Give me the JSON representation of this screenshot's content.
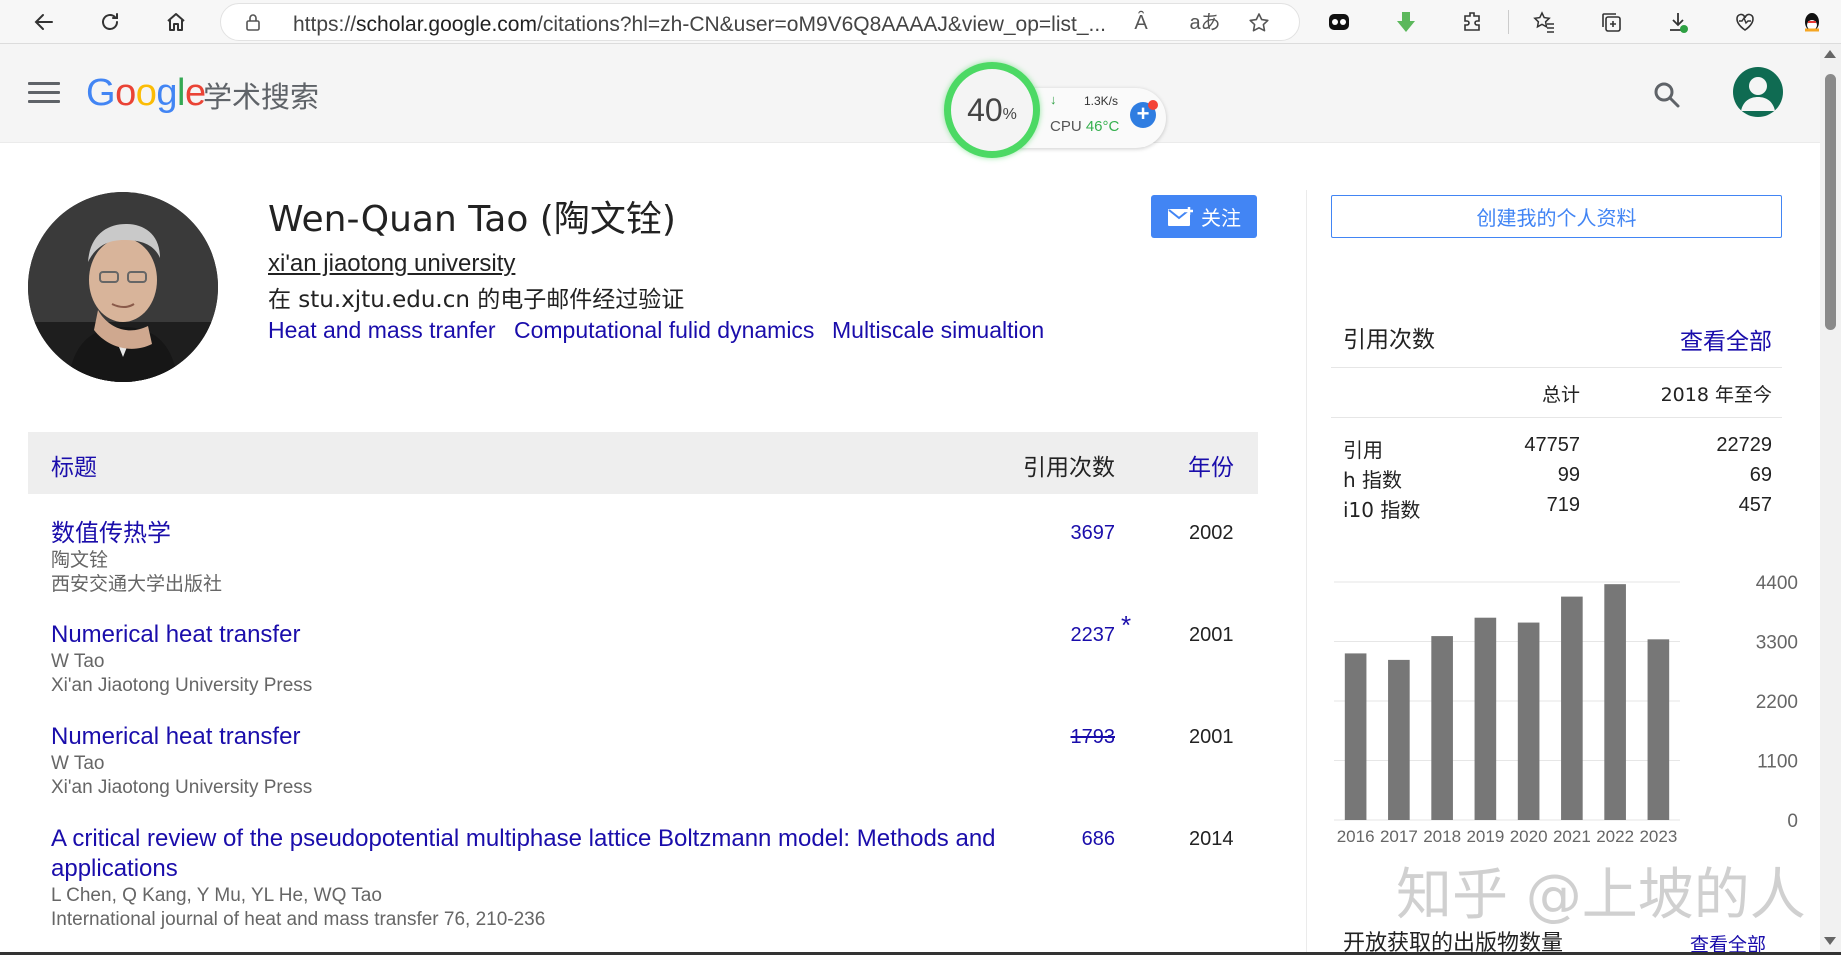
{
  "browser": {
    "url_prefix": "https://",
    "url_host": "scholar.google.com",
    "url_path": "/citations?hl=zh-CN&user=oM9V6Q8AAAAJ&view_op=list_...",
    "read_aloud_label": "Ȃ",
    "translate_label": "aあ"
  },
  "header": {
    "logo_letters": [
      "G",
      "o",
      "o",
      "g",
      "l",
      "e"
    ],
    "logo_colors": [
      "#4285f4",
      "#ea4335",
      "#fbbc05",
      "#4285f4",
      "#34a853",
      "#ea4335"
    ],
    "logo_sub": "学术搜索"
  },
  "cpu_widget": {
    "percent": "40",
    "percent_sign": "%",
    "arrow": "↓",
    "speed": "1.3K/s",
    "label": "CPU ",
    "temp": "46°C",
    "plus": "+",
    "ring_color": "#4cd964"
  },
  "profile": {
    "name": "Wen-Quan Tao (陶文铨)",
    "affiliation": "xi'an jiaotong university",
    "email_verified": "在 stu.xjtu.edu.cn 的电子邮件经过验证",
    "interests": [
      "Heat and mass tranfer",
      "Computational fulid dynamics",
      "Multiscale simualtion"
    ],
    "follow_label": "关注"
  },
  "table": {
    "col_title": "标题",
    "col_cites": "引用次数",
    "col_year": "年份",
    "rows": [
      {
        "title": "数值传热学",
        "authors": "陶文铨",
        "venue": "西安交通大学出版社",
        "cites": "3697",
        "year": "2002"
      },
      {
        "title": "Numerical heat transfer",
        "authors": "W Tao",
        "venue": "Xi'an Jiaotong University Press",
        "cites": "2237",
        "star": "*",
        "year": "2001"
      },
      {
        "title": "Numerical heat transfer",
        "authors": "W Tao",
        "venue": "Xi'an Jiaotong University Press",
        "cites": "1793",
        "year": "2001"
      },
      {
        "title_line1": "A critical review of the pseudopotential multiphase lattice Boltzmann model: Methods and",
        "title_line2": "applications",
        "authors": "L Chen, Q Kang, Y Mu, YL He, WQ Tao",
        "venue": "International journal of heat and mass transfer 76, 210-236",
        "cites": "686",
        "year": "2014"
      }
    ]
  },
  "sidebar": {
    "create_profile": "创建我的个人资料",
    "cited_by_title": "引用次数",
    "view_all": "查看全部",
    "col_total": "总计",
    "col_since": "2018 年至今",
    "stats": [
      {
        "label": "引用",
        "total": "47757",
        "since": "22729"
      },
      {
        "label": "h 指数",
        "total": "99",
        "since": "69"
      },
      {
        "label": "i10 指数",
        "total": "719",
        "since": "457"
      }
    ],
    "open_access_title": "开放获取的出版物数量",
    "open_access_view_all": "查看全部"
  },
  "chart_data": {
    "type": "bar",
    "categories": [
      "2016",
      "2017",
      "2018",
      "2019",
      "2020",
      "2021",
      "2022",
      "2023"
    ],
    "values": [
      3080,
      2960,
      3400,
      3740,
      3650,
      4130,
      4360,
      3340
    ],
    "y_ticks": [
      "4400",
      "3300",
      "2200",
      "1100",
      "0"
    ],
    "ylim": [
      0,
      4400
    ],
    "grid": true,
    "bar_color": "#777777"
  },
  "watermark": "知乎 @上坡的人"
}
